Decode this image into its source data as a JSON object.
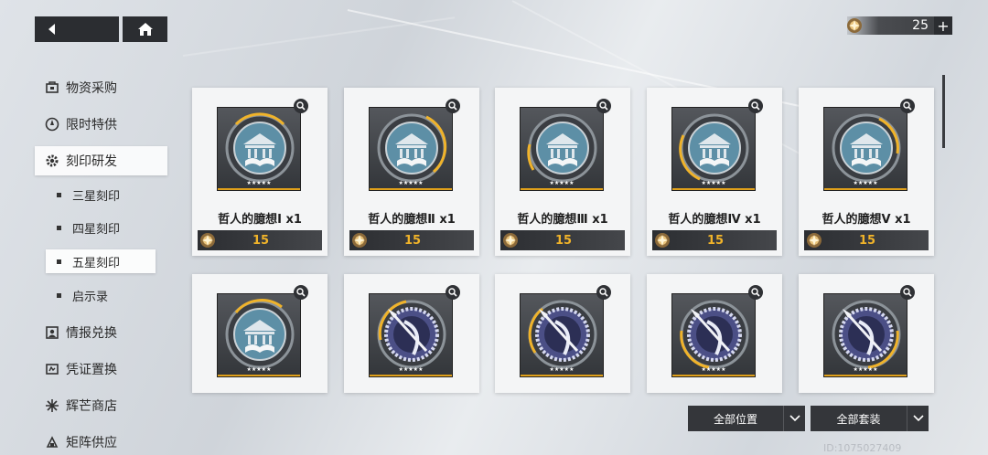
{
  "nav": {
    "back_icon": "back-arrow-icon",
    "home_icon": "home-icon"
  },
  "currency": {
    "icon": "star-coin-icon",
    "amount": "25",
    "plus": "+"
  },
  "sidebar": {
    "items": [
      {
        "label": "物资采购",
        "icon": "supply-icon"
      },
      {
        "label": "限时特供",
        "icon": "limited-icon"
      },
      {
        "label": "刻印研发",
        "icon": "gear-icon"
      },
      {
        "label": "情报兑换",
        "icon": "intel-icon"
      },
      {
        "label": "凭证置换",
        "icon": "voucher-icon"
      },
      {
        "label": "辉芒商店",
        "icon": "sparkle-icon"
      },
      {
        "label": "矩阵供应",
        "icon": "matrix-icon"
      }
    ],
    "subitems": [
      {
        "label": "三星刻印"
      },
      {
        "label": "四星刻印"
      },
      {
        "label": "五星刻印"
      },
      {
        "label": "启示录"
      }
    ]
  },
  "cards": [
    {
      "name": "哲人的臆想Ⅰ x1",
      "price": "15",
      "stars": "★★★★★",
      "emblem": "temple"
    },
    {
      "name": "哲人的臆想Ⅱ x1",
      "price": "15",
      "stars": "★★★★★",
      "emblem": "temple"
    },
    {
      "name": "哲人的臆想Ⅲ x1",
      "price": "15",
      "stars": "★★★★★",
      "emblem": "temple"
    },
    {
      "name": "哲人的臆想Ⅳ x1",
      "price": "15",
      "stars": "★★★★★",
      "emblem": "temple"
    },
    {
      "name": "哲人的臆想Ⅴ x1",
      "price": "15",
      "stars": "★★★★★",
      "emblem": "temple"
    },
    {
      "stars": "★★★★★",
      "emblem": "temple"
    },
    {
      "stars": "★★★★★",
      "emblem": "spear"
    },
    {
      "stars": "★★★★★",
      "emblem": "spear"
    },
    {
      "stars": "★★★★★",
      "emblem": "spear"
    },
    {
      "stars": "★★★★★",
      "emblem": "spear"
    }
  ],
  "filters": {
    "position": "全部位置",
    "set": "全部套装"
  },
  "uid": "ID:1075027409",
  "colors": {
    "accent_gold": "#f0b32a",
    "dark": "#2b2d31"
  }
}
